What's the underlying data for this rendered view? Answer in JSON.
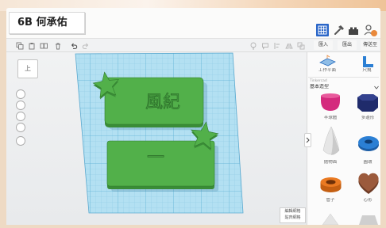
{
  "sticker_label": "6B 何承佑",
  "colors": {
    "accent": "#2a66c8"
  },
  "header": {
    "icons": [
      "grid-view-icon",
      "hammer-icon",
      "brick-icon",
      "user-avatar-icon"
    ]
  },
  "toolbar": {
    "left_icons": [
      "copy-icon",
      "paste-icon",
      "duplicate-icon",
      "delete-icon",
      "undo-icon",
      "redo-icon"
    ],
    "right_icons": [
      "lightbulb-icon",
      "comment-icon",
      "align-icon",
      "mirror-icon",
      "group-icon"
    ],
    "tabs": [
      "匯入",
      "匯出",
      "傳送至"
    ]
  },
  "view_cube": {
    "face_label": "上"
  },
  "view_controls": [
    "home-view-icon",
    "fit-view-icon",
    "zoom-in-icon",
    "zoom-out-icon",
    "perspective-icon"
  ],
  "workspace": {
    "plates": [
      {
        "text": "風紀",
        "decoration": "star-icon"
      },
      {
        "text": "一",
        "decoration": "star-icon"
      }
    ],
    "colors": {
      "plate": "#52b04a",
      "plate_side": "#3a8c37",
      "workplane": "#b3e0f2",
      "grid_line": "#8ccbe5"
    }
  },
  "panel": {
    "tools": [
      {
        "label": "工作平面",
        "icon": "workplane-icon"
      },
      {
        "label": "尺規",
        "icon": "ruler-icon"
      }
    ],
    "library": {
      "source": "Tinkercad",
      "category": "基本造型"
    },
    "shapes": [
      {
        "label": "半球體",
        "color": "#d42a7d"
      },
      {
        "label": "多邊形",
        "color": "#1f2b6b"
      },
      {
        "label": "拋物面",
        "color": "#e6e6e6"
      },
      {
        "label": "圓環",
        "color": "#2b7fd4"
      },
      {
        "label": "管子",
        "color": "#ea7a22"
      },
      {
        "label": "心形",
        "color": "#9b5a3c"
      }
    ]
  },
  "grid_settings": {
    "edit_label": "編輯網格",
    "snap_label": "貼齊網格"
  }
}
